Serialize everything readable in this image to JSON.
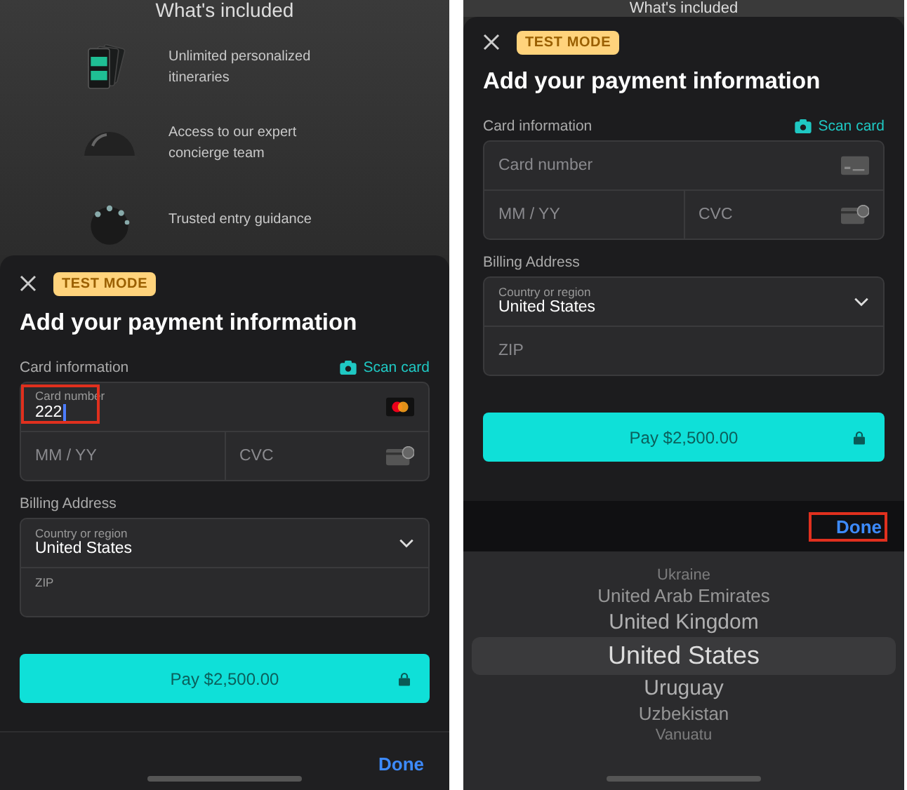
{
  "screens": [
    {
      "heading": "What's included",
      "features": [
        {
          "text": "Unlimited personalized itineraries"
        },
        {
          "text": "Access to our expert concierge team"
        },
        {
          "text": "Trusted entry guidance"
        }
      ],
      "sheet": {
        "badge": "TEST MODE",
        "title": "Add your payment information",
        "card_label": "Card information",
        "scan": "Scan card",
        "card_number": {
          "label": "Card number",
          "value": "222",
          "focused": true,
          "highlighted": true
        },
        "expiry": {
          "placeholder": "MM / YY"
        },
        "cvc": {
          "placeholder": "CVC"
        },
        "billing_label": "Billing Address",
        "country": {
          "label": "Country or region",
          "value": "United States"
        },
        "zip": {
          "label": "ZIP"
        },
        "pay": "Pay $2,500.00"
      },
      "done": {
        "text": "Done",
        "highlighted": false
      }
    },
    {
      "heading": "What's included",
      "sheet": {
        "badge": "TEST MODE",
        "title": "Add your payment information",
        "card_label": "Card information",
        "scan": "Scan card",
        "card_number": {
          "placeholder": "Card number",
          "focused": false,
          "highlighted": false
        },
        "expiry": {
          "placeholder": "MM / YY"
        },
        "cvc": {
          "placeholder": "CVC"
        },
        "billing_label": "Billing Address",
        "country": {
          "label": "Country or region",
          "value": "United States"
        },
        "zip": {
          "placeholder": "ZIP"
        },
        "pay": "Pay $2,500.00"
      },
      "done": {
        "text": "Done",
        "highlighted": true
      },
      "picker": [
        {
          "text": "Ukraine",
          "selected": false
        },
        {
          "text": "United Arab Emirates",
          "selected": false
        },
        {
          "text": "United Kingdom",
          "selected": false
        },
        {
          "text": "United States",
          "selected": true
        },
        {
          "text": "Uruguay",
          "selected": false
        },
        {
          "text": "Uzbekistan",
          "selected": false
        },
        {
          "text": "Vanuatu",
          "selected": false
        }
      ]
    }
  ]
}
